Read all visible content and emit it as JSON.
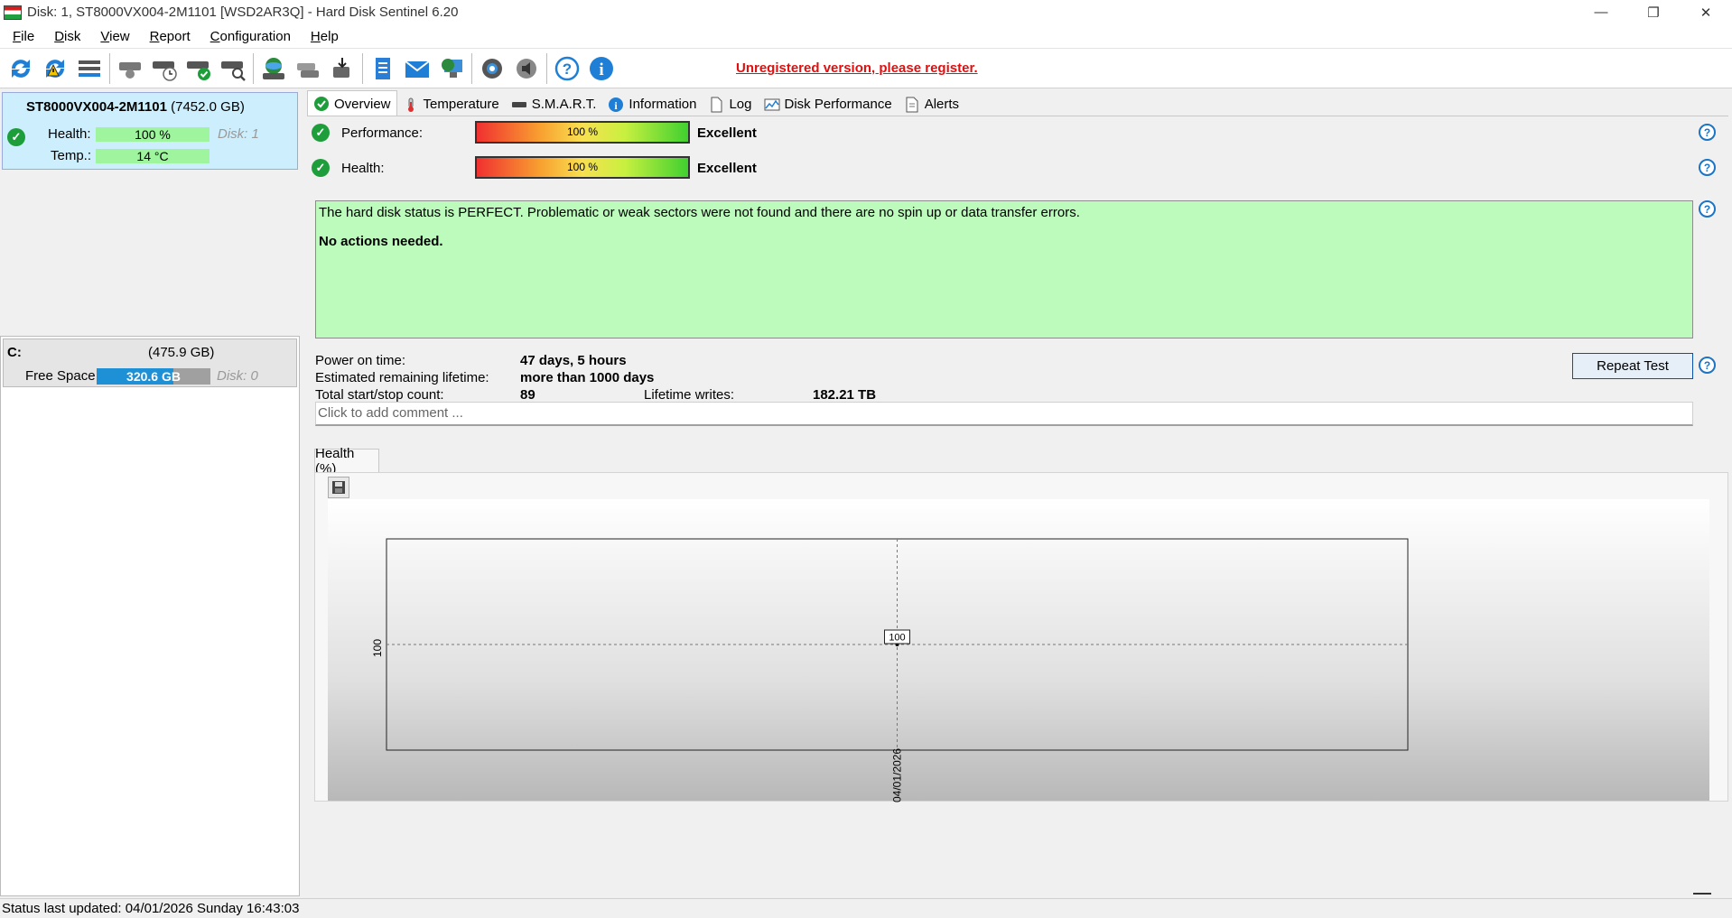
{
  "window": {
    "title": "Disk: 1, ST8000VX004-2M1101 [WSD2AR3Q]  -  Hard Disk Sentinel 6.20",
    "minimize": "—",
    "maximize": "❐",
    "close": "✕"
  },
  "menu": [
    "File",
    "Disk",
    "View",
    "Report",
    "Configuration",
    "Help"
  ],
  "toolbar": {
    "icons": [
      "refresh-icon",
      "refresh-all-icon",
      "disk-list-icon",
      "disk-info-icon",
      "disk-schedule-icon",
      "disk-check-icon",
      "disk-search-icon",
      "globe-disk-icon",
      "disk-copy-icon",
      "disk-export-icon",
      "report-icon",
      "mail-icon",
      "network-icon",
      "settings-icon",
      "sound-icon",
      "help-icon",
      "info-icon"
    ],
    "register_text": "Unregistered version, please register."
  },
  "disk": {
    "name": "ST8000VX004-2M1101",
    "size": "(7452.0 GB)",
    "health_label": "Health:",
    "health_value": "100 %",
    "temp_label": "Temp.:",
    "temp_value": "14 °C",
    "disk_index": "Disk: 1"
  },
  "volume": {
    "letter": "C:",
    "size": "(475.9 GB)",
    "free_label": "Free Space",
    "free_value": "320.6 GB",
    "free_fraction": 0.674,
    "disk_index": "Disk: 0"
  },
  "tabs": [
    {
      "label": "Overview",
      "icon": "check-circle-icon"
    },
    {
      "label": "Temperature",
      "icon": "thermometer-icon"
    },
    {
      "label": "S.M.A.R.T.",
      "icon": "smart-icon"
    },
    {
      "label": "Information",
      "icon": "info-icon"
    },
    {
      "label": "Log",
      "icon": "log-icon"
    },
    {
      "label": "Disk Performance",
      "icon": "chart-icon"
    },
    {
      "label": "Alerts",
      "icon": "alerts-icon"
    }
  ],
  "overview": {
    "performance_label": "Performance:",
    "performance_value": "100 %",
    "performance_verdict": "Excellent",
    "health_label": "Health:",
    "health_value": "100 %",
    "health_verdict": "Excellent",
    "status_text": "The hard disk status is PERFECT. Problematic or weak sectors were not found and there are no spin up or data transfer errors.",
    "action_text": "No actions needed.",
    "power_on_label": "Power on time:",
    "power_on_value": "47 days, 5 hours",
    "remaining_label": "Estimated remaining lifetime:",
    "remaining_value": "more than 1000 days",
    "startstop_label": "Total start/stop count:",
    "startstop_value": "89",
    "writes_label": "Lifetime writes:",
    "writes_value": "182.21 TB",
    "repeat_button": "Repeat Test",
    "comment_placeholder": "Click to add comment ...",
    "chart_tab": "Health (%)"
  },
  "chart_data": {
    "type": "line",
    "x": [
      "04/01/2026"
    ],
    "series": [
      {
        "values": [
          100
        ]
      }
    ],
    "xlabel": "",
    "ylabel": "",
    "ytick_labels": [
      "100"
    ],
    "xtick_labels": [
      "04/01/2026"
    ],
    "data_labels": [
      "100"
    ],
    "grid": true
  },
  "statusbar": {
    "text": "Status last updated: 04/01/2026 Sunday 16:43:03"
  },
  "colors": {
    "register": "#e01010",
    "status_ok": "#bdfbbd",
    "selected_disk": "#cdeefc",
    "accent": "#1c74c4"
  }
}
